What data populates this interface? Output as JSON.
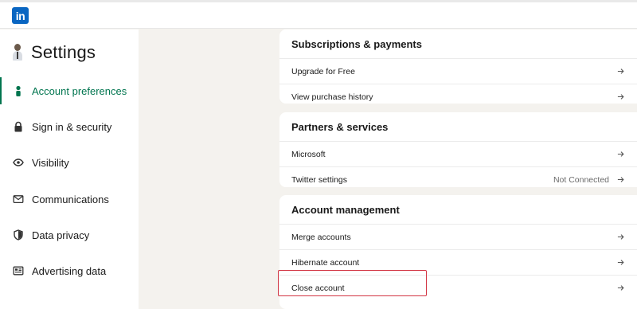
{
  "brand": {
    "logo_text": "in",
    "color": "#0a66c2"
  },
  "sidebar": {
    "title": "Settings",
    "active_color": "#01754f",
    "items": [
      {
        "label": "Account preferences",
        "icon": "person-icon",
        "active": true
      },
      {
        "label": "Sign in & security",
        "icon": "lock-icon",
        "active": false
      },
      {
        "label": "Visibility",
        "icon": "eye-icon",
        "active": false
      },
      {
        "label": "Communications",
        "icon": "envelope-icon",
        "active": false
      },
      {
        "label": "Data privacy",
        "icon": "shield-icon",
        "active": false
      },
      {
        "label": "Advertising data",
        "icon": "newspaper-icon",
        "active": false
      }
    ]
  },
  "sections": [
    {
      "title": "Subscriptions & payments",
      "rows": [
        {
          "label": "Upgrade for Free"
        },
        {
          "label": "View purchase history"
        }
      ]
    },
    {
      "title": "Partners & services",
      "rows": [
        {
          "label": "Microsoft"
        },
        {
          "label": "Twitter settings",
          "status": "Not Connected"
        }
      ]
    },
    {
      "title": "Account management",
      "rows": [
        {
          "label": "Merge accounts"
        },
        {
          "label": "Hibernate account"
        },
        {
          "label": "Close account",
          "highlighted": true
        }
      ]
    }
  ],
  "highlight_color": "#d23544"
}
